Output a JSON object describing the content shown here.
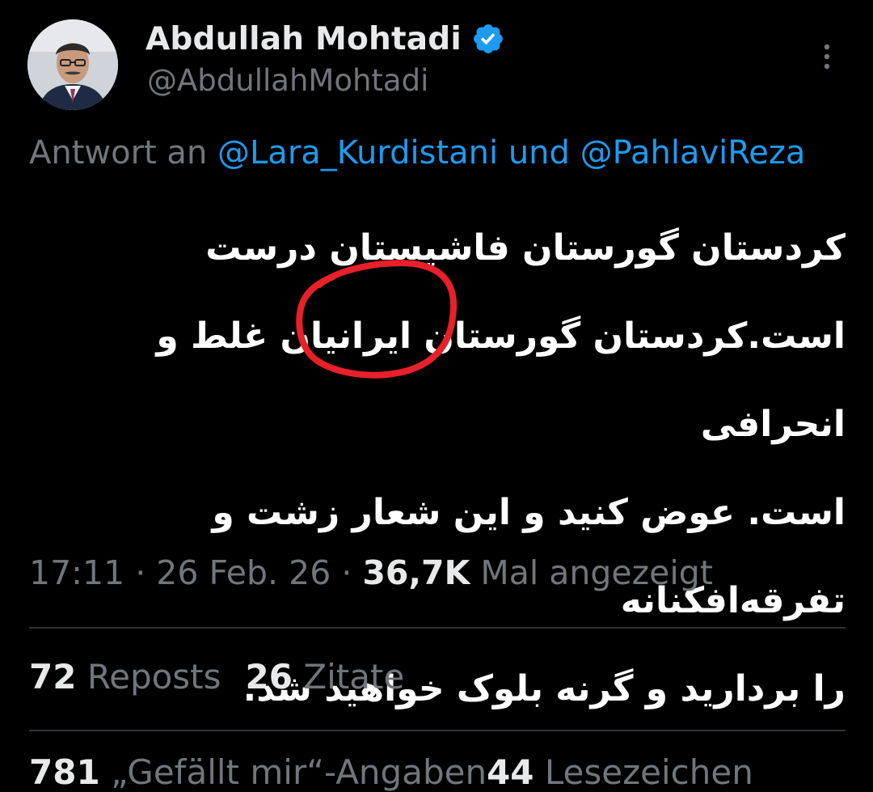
{
  "author": {
    "display_name": "Abdullah Mohtadi",
    "handle": "@AbdullahMohtadi",
    "verified_icon": "verified-badge-icon",
    "verified_color": "#1d9bf0"
  },
  "reply": {
    "prefix": "Antwort an ",
    "mention_1": "@Lara_Kurdistani",
    "joiner": " und ",
    "mention_2": "@PahlaviReza"
  },
  "tweet": {
    "text": "کردستان گورستان فاشیستان درست\nاست.کردستان گورستان ایرانیان غلط و انحرافی\nاست. عوض کنید و این شعار زشت و تفرقه‌افکنانه\nرا بردارید و گرنه بلوک خواهید شد.",
    "highlight_word": "ایرانیان",
    "highlight_color": "#e8202a"
  },
  "meta": {
    "time": "17:11",
    "sep_1": " · ",
    "date": "26 Feb. 26",
    "sep_2": " · ",
    "views": "36,7K",
    "views_label": " Mal angezeigt"
  },
  "stats": {
    "reposts_count": "72",
    "reposts_label": "Reposts",
    "quotes_count": "26",
    "quotes_label": "Zitate"
  },
  "cut_row": {
    "likes_count": "781",
    "likes_label": "„Gefällt mir“-Angaben",
    "bookmarks_count": "44",
    "bookmarks_label": "Lesezeichen"
  },
  "colors": {
    "background": "#000000",
    "primary_text": "#e7e9ea",
    "secondary_text": "#71767b",
    "link": "#1d9bf0",
    "divider": "#2f3336"
  }
}
